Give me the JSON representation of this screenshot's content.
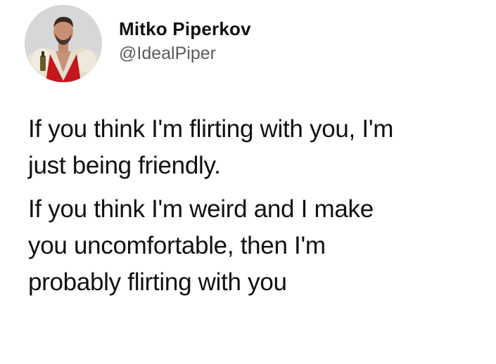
{
  "tweet": {
    "author": {
      "display_name": "Mitko Piperkov",
      "handle": "@IdealPiper",
      "avatar": "profile-photo"
    },
    "paragraphs": [
      "If you think I'm flirting with you, I'm\njust being friendly.",
      "If you think I'm weird and I make\nyou uncomfortable, then I'm\nprobably flirting with you"
    ]
  },
  "colors": {
    "background": "#ffffff",
    "text": "#111111",
    "handle": "#5b5b5b"
  }
}
